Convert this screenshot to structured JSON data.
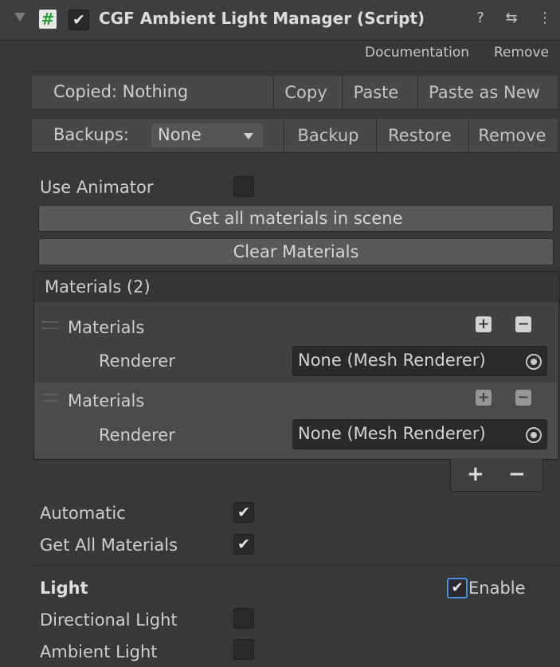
{
  "header": {
    "title": "CGF Ambient Light Manager (Script)",
    "script_icon": "#",
    "enabled_mark": "✔",
    "help_icon": "?",
    "preset_icon": "⇆",
    "menu_icon": "⋮"
  },
  "links": {
    "documentation": "Documentation",
    "remove": "Remove"
  },
  "copybar": {
    "status": "Copied: Nothing",
    "copy": "Copy",
    "paste": "Paste",
    "paste_as_new": "Paste as New"
  },
  "backupbar": {
    "label": "Backups:",
    "selected": "None",
    "backup": "Backup",
    "restore": "Restore",
    "remove": "Remove"
  },
  "fields": {
    "use_animator": "Use Animator",
    "get_all_button": "Get all materials in scene",
    "clear_button": "Clear Materials"
  },
  "materials": {
    "header": "Materials (2)",
    "items": [
      {
        "label": "Materials",
        "renderer_label": "Renderer",
        "renderer_value": "None (Mesh Renderer)"
      },
      {
        "label": "Materials",
        "renderer_label": "Renderer",
        "renderer_value": "None (Mesh Renderer)"
      }
    ],
    "add_symbol": "+",
    "remove_symbol": "−"
  },
  "options": {
    "automatic": "Automatic",
    "automatic_checked": "✔",
    "get_all_materials": "Get All Materials",
    "get_all_materials_checked": "✔"
  },
  "light": {
    "section_title": "Light",
    "enable_label": "Enable",
    "enable_checked": "✔",
    "directional": "Directional Light",
    "ambient": "Ambient Light"
  }
}
